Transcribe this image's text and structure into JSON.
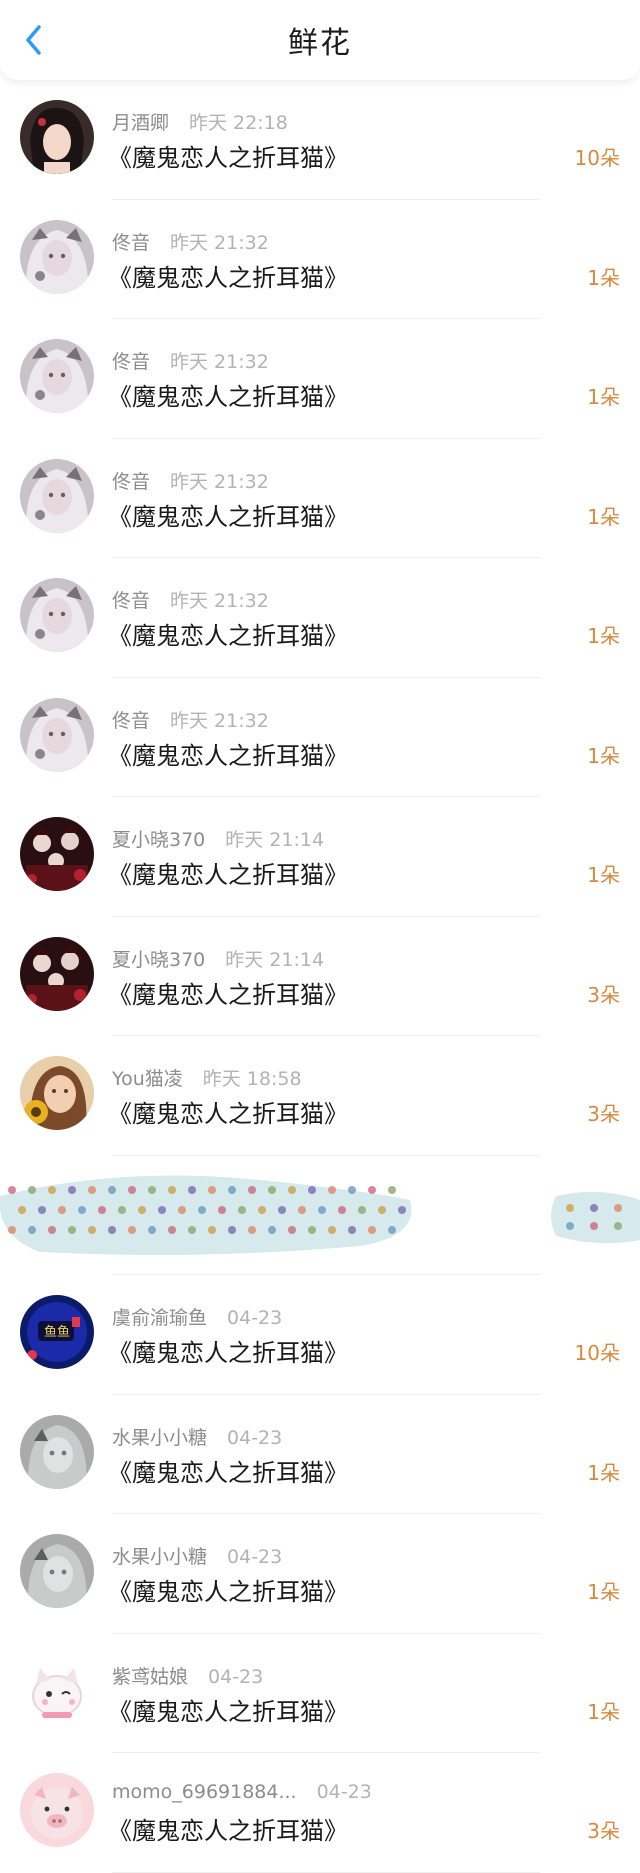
{
  "header": {
    "title": "鲜花",
    "back_icon": "chevron-left-icon",
    "accent": "#2a9df4"
  },
  "colors": {
    "count": "#d8893e",
    "name": "#8c8c8c",
    "time": "#b3b3b3"
  },
  "items": [
    {
      "name": "月酒卿",
      "time": "昨天 22:18",
      "work": "《魔鬼恋人之折耳猫》",
      "count": "10朵",
      "avatar": "avatar-portrait-dark-hair"
    },
    {
      "name": "佟音",
      "time": "昨天 21:32",
      "work": "《魔鬼恋人之折耳猫》",
      "count": "1朵",
      "avatar": "avatar-white-hair-girl"
    },
    {
      "name": "佟音",
      "time": "昨天 21:32",
      "work": "《魔鬼恋人之折耳猫》",
      "count": "1朵",
      "avatar": "avatar-white-hair-girl"
    },
    {
      "name": "佟音",
      "time": "昨天 21:32",
      "work": "《魔鬼恋人之折耳猫》",
      "count": "1朵",
      "avatar": "avatar-white-hair-girl"
    },
    {
      "name": "佟音",
      "time": "昨天 21:32",
      "work": "《魔鬼恋人之折耳猫》",
      "count": "1朵",
      "avatar": "avatar-white-hair-girl"
    },
    {
      "name": "佟音",
      "time": "昨天 21:32",
      "work": "《魔鬼恋人之折耳猫》",
      "count": "1朵",
      "avatar": "avatar-white-hair-girl"
    },
    {
      "name": "夏小晓370",
      "time": "昨天 21:14",
      "work": "《魔鬼恋人之折耳猫》",
      "count": "1朵",
      "avatar": "avatar-dark-red-group"
    },
    {
      "name": "夏小晓370",
      "time": "昨天 21:14",
      "work": "《魔鬼恋人之折耳猫》",
      "count": "3朵",
      "avatar": "avatar-dark-red-group"
    },
    {
      "name": "You猫凌",
      "time": "昨天 18:58",
      "work": "《魔鬼恋人之折耳猫》",
      "count": "3朵",
      "avatar": "avatar-sunflower-girl"
    },
    {
      "redacted": true
    },
    {
      "name": "虞俞渝瑜鱼",
      "time": "04-23",
      "work": "《魔鬼恋人之折耳猫》",
      "count": "10朵",
      "avatar": "avatar-blue-neon-logo"
    },
    {
      "name": "水果小小糖",
      "time": "04-23",
      "work": "《魔鬼恋人之折耳猫》",
      "count": "1朵",
      "avatar": "avatar-gray-anime-girl"
    },
    {
      "name": "水果小小糖",
      "time": "04-23",
      "work": "《魔鬼恋人之折耳猫》",
      "count": "1朵",
      "avatar": "avatar-gray-anime-girl"
    },
    {
      "name": "紫鸢姑娘",
      "time": "04-23",
      "work": "《魔鬼恋人之折耳猫》",
      "count": "1朵",
      "avatar": "avatar-white-cat-sticker"
    },
    {
      "name": "momo_69691884...",
      "time": "04-23",
      "work": "《魔鬼恋人之折耳猫》",
      "count": "3朵",
      "avatar": "avatar-pink-pig-sticker"
    }
  ]
}
